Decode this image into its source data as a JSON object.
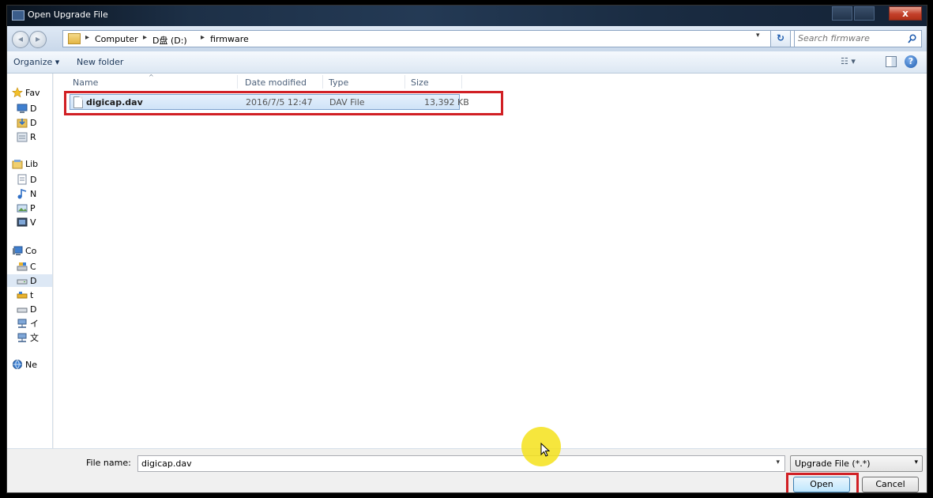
{
  "window": {
    "title": "Open Upgrade File",
    "close_label": "x"
  },
  "address": {
    "crumbs": [
      "Computer",
      "D盘 (D:)",
      "firmware"
    ],
    "separator": "▸",
    "refresh_label": "↻",
    "dropdown_glyph": "▾"
  },
  "search": {
    "placeholder": "Search firmware"
  },
  "toolbar": {
    "organize_label": "Organize ▾",
    "new_folder_label": "New folder",
    "views_label": "☷ ▾",
    "help_label": "?"
  },
  "navpane": {
    "items": [
      {
        "label": "Fav",
        "icon": "star-icon"
      },
      {
        "label": "D",
        "icon": "desktop-icon"
      },
      {
        "label": "D",
        "icon": "downloads-icon"
      },
      {
        "label": "R",
        "icon": "recent-places-icon"
      },
      {
        "label": "Lib",
        "icon": "libraries-icon"
      },
      {
        "label": "D",
        "icon": "documents-icon"
      },
      {
        "label": "N",
        "icon": "music-icon"
      },
      {
        "label": "P",
        "icon": "pictures-icon"
      },
      {
        "label": "V",
        "icon": "videos-icon"
      },
      {
        "label": "Co",
        "icon": "computer-icon"
      },
      {
        "label": "C",
        "icon": "drive-c-icon"
      },
      {
        "label": "D",
        "icon": "drive-d-icon"
      },
      {
        "label": "t",
        "icon": "network-drive-icon"
      },
      {
        "label": "D",
        "icon": "drive-icon"
      },
      {
        "label": "イ",
        "icon": "network-share-icon"
      },
      {
        "label": "文",
        "icon": "network-share-icon"
      },
      {
        "label": "Ne",
        "icon": "network-icon"
      }
    ]
  },
  "filelist": {
    "columns": [
      "Name",
      "Date modified",
      "Type",
      "Size"
    ],
    "sort_glyph": "^",
    "rows": [
      {
        "name": "digicap.dav",
        "date": "2016/7/5 12:47",
        "type": "DAV File",
        "size": "13,392 KB"
      }
    ]
  },
  "bottom": {
    "filename_label": "File name:",
    "filename_value": "digicap.dav",
    "filename_dd": "▾",
    "filetype_value": "Upgrade File (*.*)",
    "filetype_dd": "▾",
    "open_label": "Open",
    "cancel_label": "Cancel"
  },
  "colors": {
    "highlight": "#d11f24",
    "selection": "#cfe3f8",
    "cursor_halo": "#f4e21b"
  }
}
